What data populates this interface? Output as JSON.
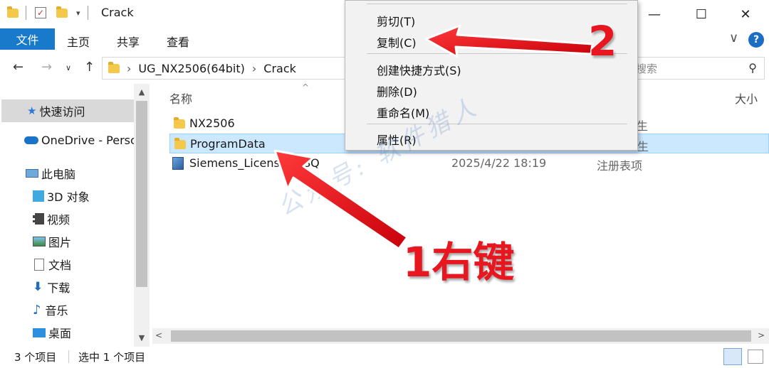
{
  "window": {
    "title": "Crack",
    "minimize": "—",
    "maximize": "☐",
    "close": "✕"
  },
  "ribbon": {
    "tabs": [
      "文件",
      "主页",
      "共享",
      "查看"
    ],
    "help": "?"
  },
  "address": {
    "crumbs": [
      "UG_NX2506(64bit)",
      "Crack"
    ],
    "search_placeholder": "搜索"
  },
  "nav_pane": {
    "quick_access": "快速访问",
    "onedrive": "OneDrive - Persc",
    "this_pc": "此电脑",
    "items": [
      "3D 对象",
      "视频",
      "图片",
      "文档",
      "下载",
      "音乐",
      "桌面"
    ]
  },
  "file_list": {
    "columns": [
      "名称",
      "大小"
    ],
    "rows": [
      {
        "name": "NX2506",
        "date": "",
        "type": "生"
      },
      {
        "name": "ProgramData",
        "date": "",
        "type": "生"
      },
      {
        "name": "Siemens_Licensin",
        "name_tail": "SQ",
        "date": "2025/4/22 18:19",
        "type": "注册表项"
      }
    ]
  },
  "status": {
    "count": "3 个项目",
    "selected": "选中 1 个项目"
  },
  "context_menu": {
    "items": [
      "剪切(T)",
      "复制(C)",
      "创建快捷方式(S)",
      "删除(D)",
      "重命名(M)",
      "属性(R)"
    ]
  },
  "annotations": {
    "step1": "1右键",
    "step2": "2",
    "watermark": "公众号: 软件猎人"
  },
  "colors": {
    "accent": "#1979ca",
    "selection": "#cce8ff",
    "annotation": "#e8161f"
  }
}
